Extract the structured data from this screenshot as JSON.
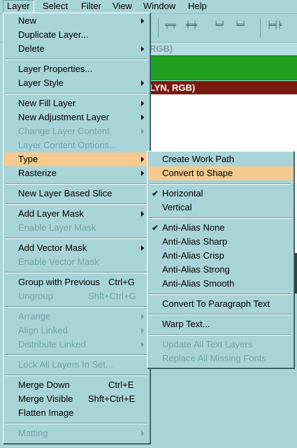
{
  "menubar": {
    "items": [
      "Layer",
      "Select",
      "Filter",
      "View",
      "Window",
      "Help"
    ]
  },
  "documents": {
    "doc1_title": "RGB)",
    "doc2_title": "LYN, RGB)"
  },
  "layer_menu": {
    "items": [
      {
        "label": "New",
        "submenu": true
      },
      {
        "label": "Duplicate Layer..."
      },
      {
        "label": "Delete",
        "submenu": true
      },
      {
        "label": "Layer Properties..."
      },
      {
        "label": "Layer Style",
        "submenu": true
      },
      {
        "label": "New Fill Layer",
        "submenu": true
      },
      {
        "label": "New Adjustment Layer",
        "submenu": true
      },
      {
        "label": "Change Layer Content",
        "submenu": true,
        "disabled": true
      },
      {
        "label": "Layer Content Options...",
        "disabled": true
      },
      {
        "label": "Type",
        "submenu": true,
        "highlighted": true
      },
      {
        "label": "Rasterize",
        "submenu": true
      },
      {
        "label": "New Layer Based Slice"
      },
      {
        "label": "Add Layer Mask",
        "submenu": true
      },
      {
        "label": "Enable Layer Mask",
        "disabled": true
      },
      {
        "label": "Add Vector Mask",
        "submenu": true
      },
      {
        "label": "Enable Vector Mask",
        "disabled": true
      },
      {
        "label": "Group with Previous",
        "shortcut": "Ctrl+G"
      },
      {
        "label": "Ungroup",
        "shortcut": "Shft+Ctrl+G",
        "disabled": true
      },
      {
        "label": "Arrange",
        "submenu": true,
        "disabled": true
      },
      {
        "label": "Align Linked",
        "submenu": true,
        "disabled": true
      },
      {
        "label": "Distribute Linked",
        "submenu": true,
        "disabled": true
      },
      {
        "label": "Lock All Layers In Set...",
        "disabled": true
      },
      {
        "label": "Merge Down",
        "shortcut": "Ctrl+E"
      },
      {
        "label": "Merge Visible",
        "shortcut": "Shft+Ctrl+E"
      },
      {
        "label": "Flatten Image"
      },
      {
        "label": "Matting",
        "submenu": true,
        "disabled": true
      }
    ]
  },
  "type_menu": {
    "items": [
      {
        "label": "Create Work Path"
      },
      {
        "label": "Convert to Shape",
        "highlighted": true
      },
      {
        "label": "Horizontal",
        "checked": true
      },
      {
        "label": "Vertical"
      },
      {
        "label": "Anti-Alias None",
        "checked": true
      },
      {
        "label": "Anti-Alias Sharp"
      },
      {
        "label": "Anti-Alias Crisp"
      },
      {
        "label": "Anti-Alias Strong"
      },
      {
        "label": "Anti-Alias Smooth"
      },
      {
        "label": "Convert To Paragraph Text"
      },
      {
        "label": "Warp Text..."
      },
      {
        "label": "Update All Text Layers",
        "disabled": true
      },
      {
        "label": "Replace All Missing Fonts",
        "disabled": true
      }
    ]
  },
  "colors": {
    "menu_bg": "#a8d4d8",
    "highlight": "#f5c98f",
    "disabled_text": "#6fa3aa",
    "doc_green": "#1f9e1f",
    "doc_title_active": "#7a1a10"
  }
}
